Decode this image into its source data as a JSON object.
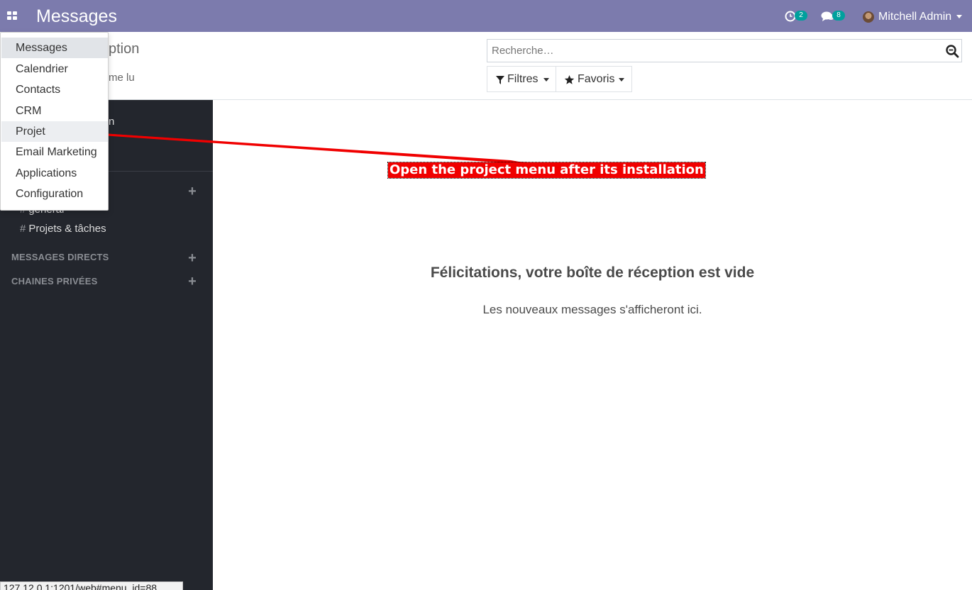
{
  "navbar": {
    "brand": "Messages",
    "activity_count": "2",
    "messages_count": "8",
    "user_name": "Mitchell Admin"
  },
  "control_panel": {
    "title_fragment": "ption",
    "mark_read_fragment": "me lu",
    "search_placeholder": "Recherche…",
    "filters_label": "Filtres",
    "favorites_label": "Favoris"
  },
  "sidebar": {
    "partial_item_1": "n",
    "channels_partial": "général",
    "channel_projects": "Projets & tâches",
    "direct_messages_header": "MESSAGES DIRECTS",
    "private_channels_header": "CHAINES PRIVÉES",
    "hash": "#"
  },
  "main": {
    "empty_title": "Félicitations, votre boîte de réception est vide",
    "empty_subtitle": "Les nouveaux messages s'afficheront ici."
  },
  "annotation": {
    "text": "Open the project menu after its installation"
  },
  "apps_menu": {
    "items": [
      {
        "label": "Messages"
      },
      {
        "label": "Calendrier"
      },
      {
        "label": "Contacts"
      },
      {
        "label": "CRM"
      },
      {
        "label": "Projet"
      },
      {
        "label": "Email Marketing"
      },
      {
        "label": "Applications"
      },
      {
        "label": "Configuration"
      }
    ]
  },
  "status_url": "127.12.0.1:1201/web#menu_id=88",
  "colors": {
    "navbar": "#7c7bad",
    "sidebar": "#23262d",
    "badge": "#00a09d",
    "annotation": "#f00000"
  }
}
